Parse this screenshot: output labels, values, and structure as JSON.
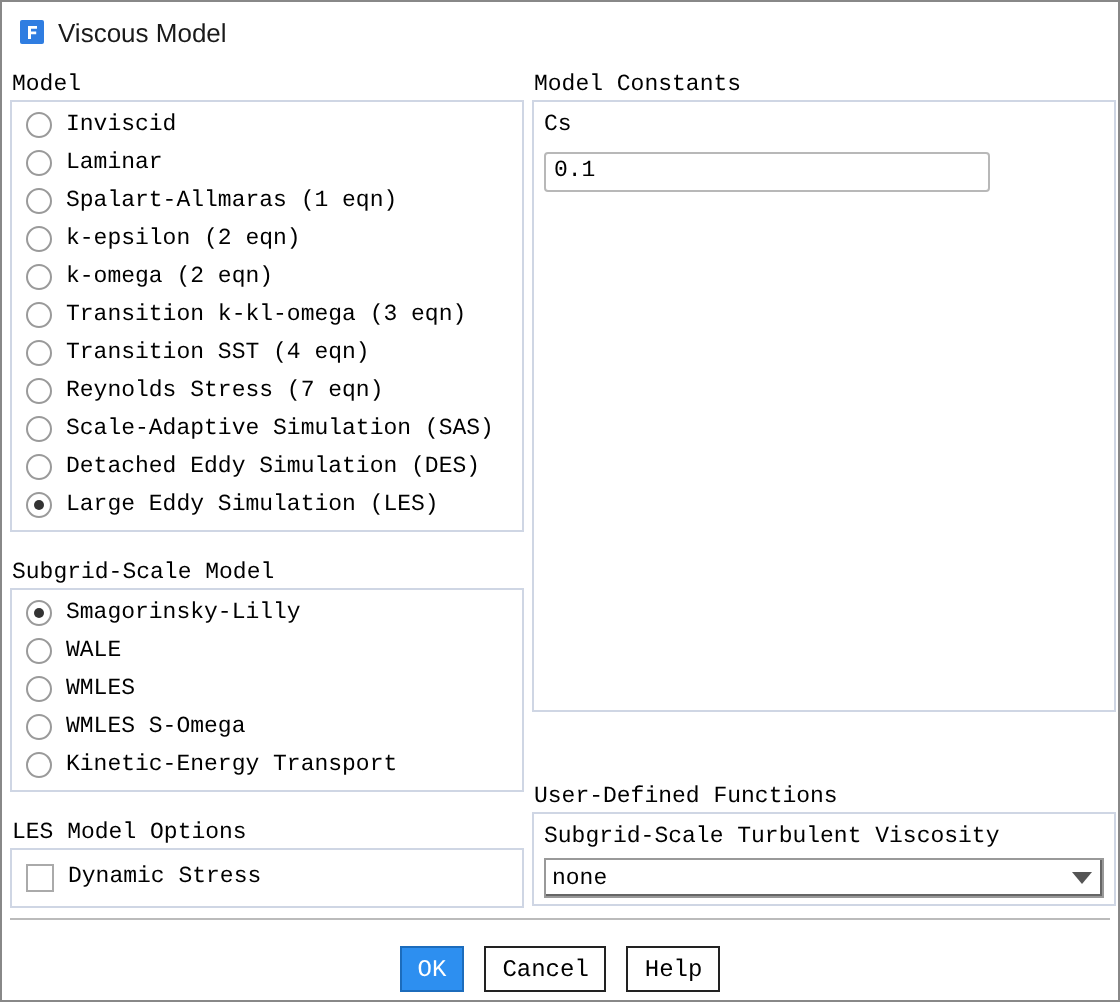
{
  "window": {
    "title": "Viscous Model"
  },
  "model": {
    "label": "Model",
    "options": [
      {
        "label": "Inviscid",
        "selected": false
      },
      {
        "label": "Laminar",
        "selected": false
      },
      {
        "label": "Spalart-Allmaras (1 eqn)",
        "selected": false
      },
      {
        "label": "k-epsilon (2 eqn)",
        "selected": false
      },
      {
        "label": "k-omega (2 eqn)",
        "selected": false
      },
      {
        "label": "Transition k-kl-omega (3 eqn)",
        "selected": false
      },
      {
        "label": "Transition SST (4 eqn)",
        "selected": false
      },
      {
        "label": "Reynolds Stress (7 eqn)",
        "selected": false
      },
      {
        "label": "Scale-Adaptive Simulation (SAS)",
        "selected": false
      },
      {
        "label": "Detached Eddy Simulation (DES)",
        "selected": false
      },
      {
        "label": "Large Eddy Simulation (LES)",
        "selected": true
      }
    ]
  },
  "subgrid_scale_model": {
    "label": "Subgrid-Scale Model",
    "options": [
      {
        "label": "Smagorinsky-Lilly",
        "selected": true
      },
      {
        "label": "WALE",
        "selected": false
      },
      {
        "label": "WMLES",
        "selected": false
      },
      {
        "label": "WMLES S-Omega",
        "selected": false
      },
      {
        "label": "Kinetic-Energy Transport",
        "selected": false
      }
    ]
  },
  "les_model_options": {
    "label": "LES Model Options",
    "checkboxes": [
      {
        "label": "Dynamic Stress",
        "checked": false
      }
    ]
  },
  "model_constants": {
    "label": "Model Constants",
    "fields": [
      {
        "label": "Cs",
        "value": "0.1"
      }
    ]
  },
  "user_defined_functions": {
    "label": "User-Defined Functions",
    "dropdowns": [
      {
        "label": "Subgrid-Scale Turbulent Viscosity",
        "value": "none"
      }
    ]
  },
  "buttons": [
    {
      "label": "OK",
      "kind": "primary"
    },
    {
      "label": "Cancel",
      "kind": "normal"
    },
    {
      "label": "Help",
      "kind": "normal"
    }
  ]
}
